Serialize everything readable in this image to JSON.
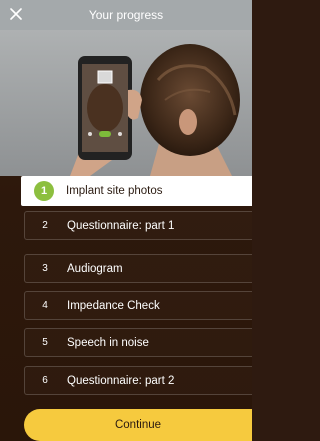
{
  "header": {
    "title": "Your progress",
    "close_icon": "close-icon"
  },
  "steps": [
    {
      "number": "1",
      "label": "Implant site photos",
      "state": "active"
    },
    {
      "number": "2",
      "label": "Questionnaire: part 1",
      "state": "pending"
    },
    {
      "number": "3",
      "label": "Audiogram",
      "state": "pending"
    },
    {
      "number": "4",
      "label": "Impedance Check",
      "state": "pending"
    },
    {
      "number": "5",
      "label": "Speech in noise",
      "state": "pending"
    },
    {
      "number": "6",
      "label": "Questionnaire: part 2",
      "state": "pending"
    }
  ],
  "continue_label": "Continue",
  "colors": {
    "header": "#a4a9ab",
    "background": "#2e1a10",
    "active_step_bg": "#ffffff",
    "step_circle": "#8cbf3f",
    "continue_button": "#f6ca3e"
  }
}
